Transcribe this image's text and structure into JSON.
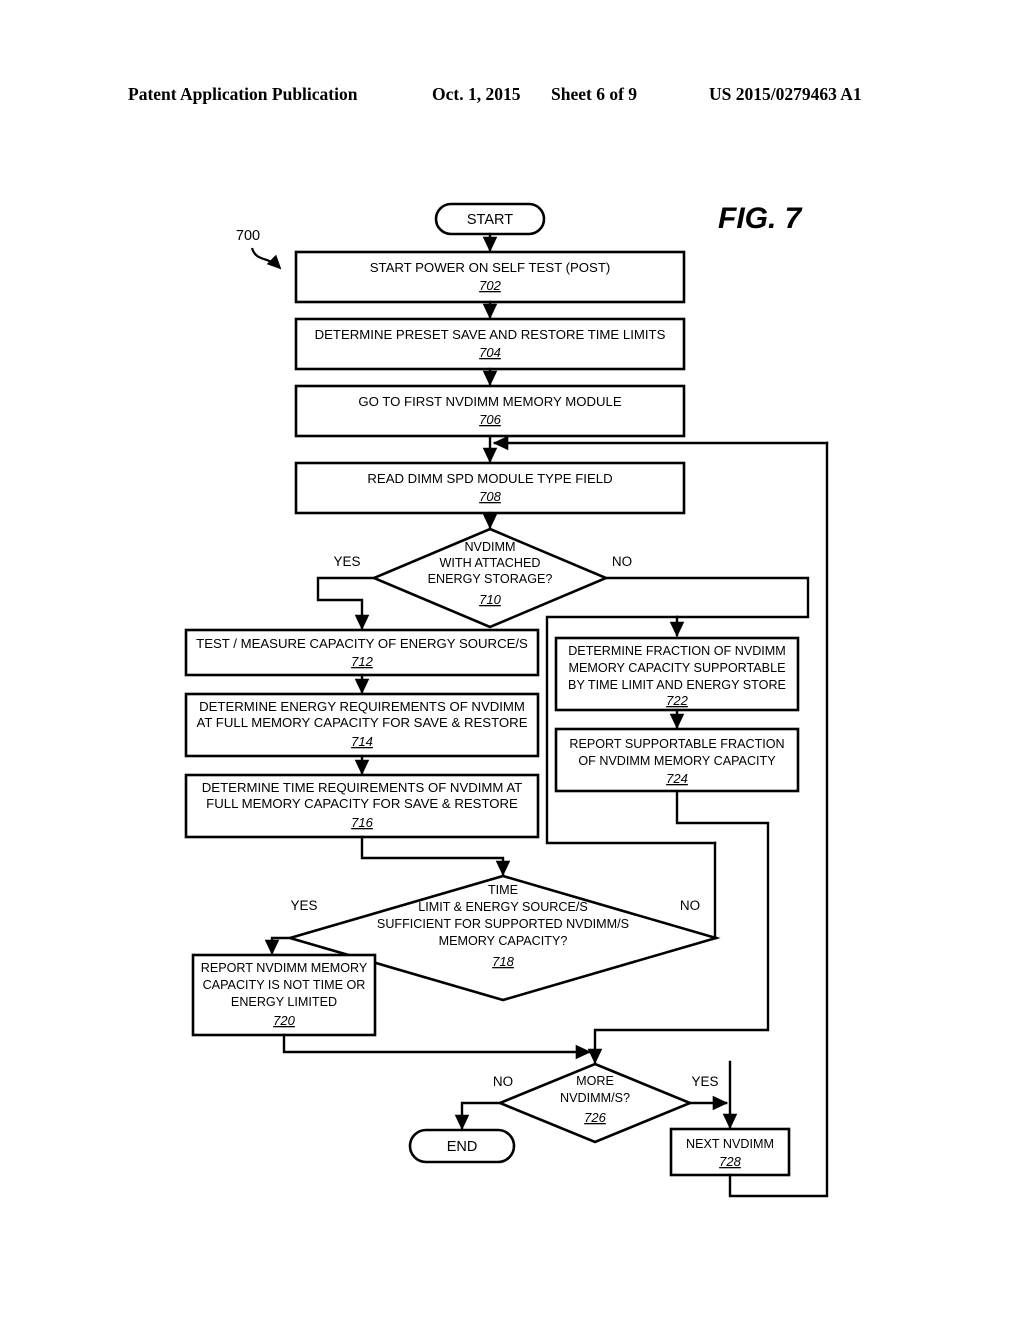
{
  "header": {
    "publication": "Patent Application Publication",
    "date": "Oct. 1, 2015",
    "sheet": "Sheet 6 of 9",
    "number": "US 2015/0279463 A1"
  },
  "figure": {
    "title": "FIG. 7",
    "diagram_ref": "700"
  },
  "flowchart": {
    "type": "flowchart",
    "start": {
      "label": "START"
    },
    "end": {
      "label": "END"
    },
    "nodes": [
      {
        "id": "702",
        "shape": "process",
        "ref": "702",
        "lines": [
          "START POWER ON SELF TEST (POST)"
        ]
      },
      {
        "id": "704",
        "shape": "process",
        "ref": "704",
        "lines": [
          "DETERMINE PRESET SAVE AND RESTORE TIME  LIMITS"
        ]
      },
      {
        "id": "706",
        "shape": "process",
        "ref": "706",
        "lines": [
          "GO TO FIRST NVDIMM MEMORY MODULE"
        ]
      },
      {
        "id": "708",
        "shape": "process",
        "ref": "708",
        "lines": [
          "READ DIMM SPD MODULE TYPE FIELD"
        ]
      },
      {
        "id": "710",
        "shape": "decision",
        "ref": "710",
        "lines": [
          "NVDIMM",
          "WITH ATTACHED",
          "ENERGY STORAGE?"
        ]
      },
      {
        "id": "712",
        "shape": "process",
        "ref": "712",
        "lines": [
          "TEST / MEASURE CAPACITY OF ENERGY SOURCE/S"
        ]
      },
      {
        "id": "714",
        "shape": "process",
        "ref": "714",
        "lines": [
          "DETERMINE ENERGY REQUIREMENTS OF NVDIMM",
          "AT FULL MEMORY CAPACITY FOR SAVE & RESTORE"
        ]
      },
      {
        "id": "716",
        "shape": "process",
        "ref": "716",
        "lines": [
          "DETERMINE TIME REQUIREMENTS OF NVDIMM AT",
          "FULL MEMORY CAPACITY FOR SAVE & RESTORE"
        ]
      },
      {
        "id": "718",
        "shape": "decision",
        "ref": "718",
        "lines": [
          "TIME",
          "LIMIT & ENERGY SOURCE/S",
          "SUFFICIENT FOR SUPPORTED NVDIMM/S",
          "MEMORY CAPACITY?"
        ]
      },
      {
        "id": "720",
        "shape": "process",
        "ref": "720",
        "lines": [
          "REPORT NVDIMM MEMORY",
          "CAPACITY IS NOT TIME OR",
          "ENERGY LIMITED"
        ]
      },
      {
        "id": "722",
        "shape": "process",
        "ref": "722",
        "lines": [
          "DETERMINE FRACTION OF NVDIMM",
          "MEMORY CAPACITY SUPPORTABLE",
          "BY TIME LIMIT AND ENERGY STORE"
        ]
      },
      {
        "id": "724",
        "shape": "process",
        "ref": "724",
        "lines": [
          "REPORT SUPPORTABLE FRACTION",
          "OF NVDIMM MEMORY CAPACITY"
        ]
      },
      {
        "id": "726",
        "shape": "decision",
        "ref": "726",
        "lines": [
          "MORE",
          "NVDIMM/S?"
        ]
      },
      {
        "id": "728",
        "shape": "process",
        "ref": "728",
        "lines": [
          "NEXT NVDIMM"
        ]
      }
    ],
    "branch_labels": {
      "d710_yes": "YES",
      "d710_no": "NO",
      "d718_yes": "YES",
      "d718_no": "NO",
      "d726_no": "NO",
      "d726_yes": "YES"
    }
  }
}
